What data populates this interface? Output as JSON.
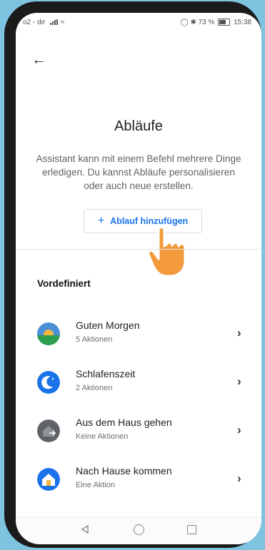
{
  "statusbar": {
    "carrier": "o2 - de",
    "right": "73 %",
    "time": "15:38"
  },
  "page": {
    "title": "Abläufe",
    "description": "Assistant kann mit einem Befehl mehrere Dinge erledigen. Du kannst Abläufe personalisieren oder auch neue erstellen.",
    "add_button": "Ablauf hinzufügen"
  },
  "section": {
    "heading": "Vordefiniert"
  },
  "routines": [
    {
      "name": "Guten Morgen",
      "sub": "5 Aktionen",
      "icon": "sunrise-icon"
    },
    {
      "name": "Schlafenszeit",
      "sub": "2 Aktionen",
      "icon": "moon-icon"
    },
    {
      "name": "Aus dem Haus gehen",
      "sub": "Keine Aktionen",
      "icon": "leave-home-icon"
    },
    {
      "name": "Nach Hause kommen",
      "sub": "Eine Aktion",
      "icon": "arrive-home-icon"
    }
  ],
  "colors": {
    "accent": "#1a73e8",
    "background": "#7ec3e0"
  }
}
